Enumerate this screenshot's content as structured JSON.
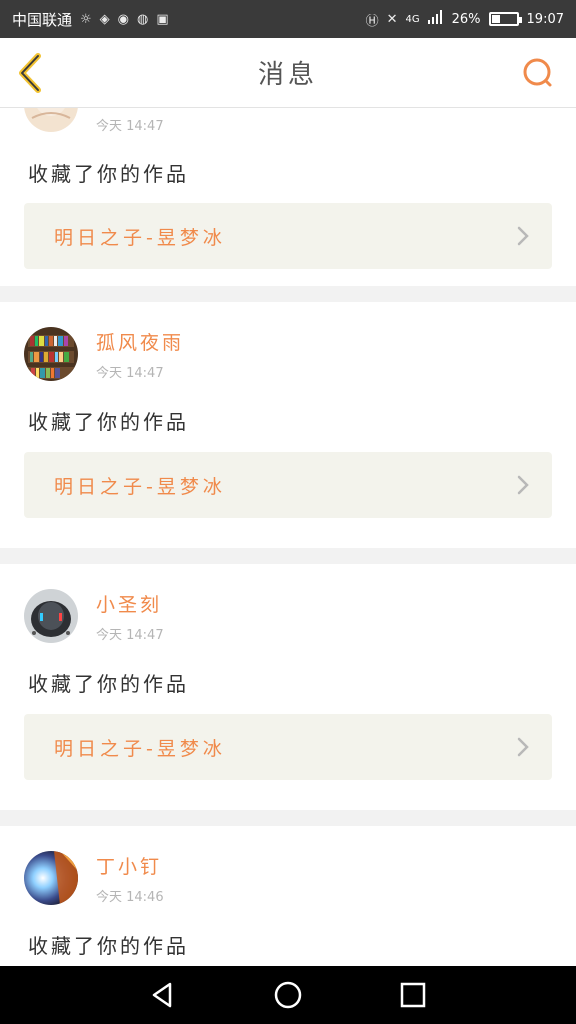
{
  "status_bar": {
    "carrier": "中国联通",
    "network": "4G",
    "battery_percent": "26%",
    "time": "19:07",
    "icons": [
      "brightness-icon",
      "cat-icon",
      "fish-icon",
      "frog-icon",
      "box-icon",
      "hd-icon",
      "mute-icon",
      "signal-icon",
      "battery-icon"
    ]
  },
  "nav": {
    "title": "消息",
    "back_icon": "chevron-left-icon",
    "search_icon": "search-icon"
  },
  "colors": {
    "accent": "#f08a4b",
    "back_arrow": "#f2c230",
    "card_bg": "#f3f3ec",
    "separator": "#f2f2f2"
  },
  "messages": [
    {
      "username": "",
      "timestamp": "今天 14:47",
      "action": "收藏了你的作品",
      "work_title": "明日之子-昱梦冰",
      "avatar": "avatar-sketch"
    },
    {
      "username": "孤风夜雨",
      "timestamp": "今天 14:47",
      "action": "收藏了你的作品",
      "work_title": "明日之子-昱梦冰",
      "avatar": "avatar-bookshelf"
    },
    {
      "username": "小圣刻",
      "timestamp": "今天 14:47",
      "action": "收藏了你的作品",
      "work_title": "明日之子-昱梦冰",
      "avatar": "avatar-robot"
    },
    {
      "username": "丁小钉",
      "timestamp": "今天 14:46",
      "action": "收藏了你的作品",
      "work_title": "",
      "avatar": "avatar-light"
    }
  ]
}
